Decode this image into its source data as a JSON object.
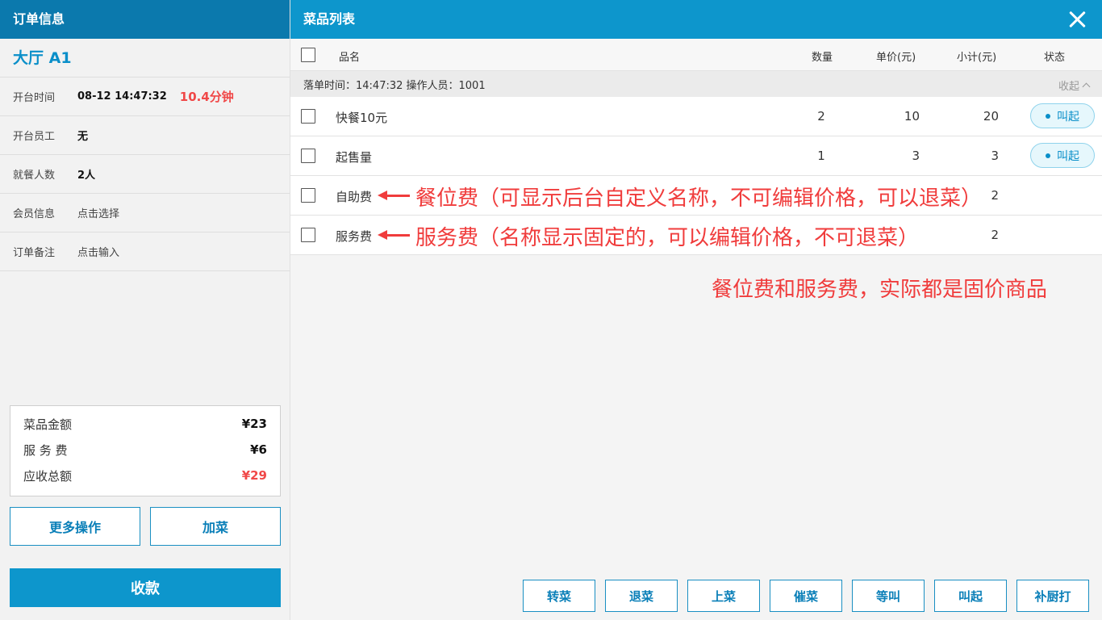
{
  "left": {
    "header": "订单信息",
    "table_name": "大厅 A1",
    "open_time": {
      "label": "开台时间",
      "value": "08-12 14:47:32",
      "duration": "10.4分钟"
    },
    "open_staff": {
      "label": "开台员工",
      "value": "无"
    },
    "guests": {
      "label": "就餐人数",
      "value": "2人"
    },
    "member": {
      "label": "会员信息",
      "value": "点击选择"
    },
    "remark": {
      "label": "订单备注",
      "value": "点击输入"
    },
    "summary": {
      "dish_amount": {
        "label": "菜品金额",
        "value": "¥23"
      },
      "service_fee": {
        "label": "服 务 费",
        "value": "¥6"
      },
      "total": {
        "label": "应收总额",
        "value": "¥29"
      }
    },
    "more_btn": "更多操作",
    "add_btn": "加菜",
    "pay_btn": "收款"
  },
  "right": {
    "header": "菜品列表",
    "columns": {
      "name": "品名",
      "qty": "数量",
      "price": "单价(元)",
      "subtotal": "小计(元)",
      "status": "状态"
    },
    "group": {
      "info": "落单时间：14:47:32  操作人员：1001",
      "collapse": "收起"
    },
    "rows": [
      {
        "name": "快餐10元",
        "qty": "2",
        "price": "10",
        "subtotal": "20",
        "status": "叫起"
      },
      {
        "name": "起售量",
        "qty": "1",
        "price": "3",
        "subtotal": "3",
        "status": "叫起"
      },
      {
        "name": "自助费",
        "qty": "",
        "price": "",
        "subtotal": "2",
        "status": ""
      },
      {
        "name": "服务费",
        "qty": "",
        "price": "",
        "subtotal": "2",
        "status": ""
      }
    ],
    "annotations": {
      "row3": "餐位费（可显示后台自定义名称，不可编辑价格，可以退菜）",
      "row4": "服务费（名称显示固定的，可以编辑价格，不可退菜）",
      "note": "餐位费和服务费，实际都是固价商品"
    },
    "actions": [
      "转菜",
      "退菜",
      "上菜",
      "催菜",
      "等叫",
      "叫起",
      "补厨打"
    ]
  },
  "colors": {
    "primary": "#0d96cc",
    "header_left": "#0b79ad",
    "red": "#f04848",
    "annotation": "#f03c3c"
  }
}
